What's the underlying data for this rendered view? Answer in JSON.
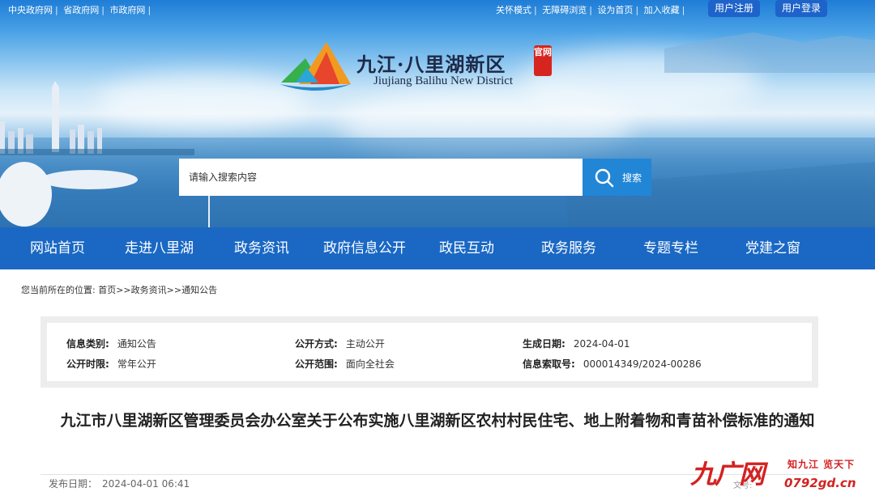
{
  "topbar": {
    "left_links": [
      "中央政府网",
      "省政府网",
      "市政府网"
    ],
    "right_links": [
      "关怀模式",
      "无障碍浏览",
      "设为首页",
      "加入收藏"
    ],
    "register_label": "用户注册",
    "login_label": "用户登录"
  },
  "logo": {
    "title": "九江·八里湖新区",
    "seal": "官网",
    "subtitle": "Jiujiang Balihu New District"
  },
  "search": {
    "placeholder": "请输入搜索内容",
    "button_label": "搜索"
  },
  "nav": {
    "items": [
      "网站首页",
      "走进八里湖",
      "政务资讯",
      "政府信息公开",
      "政民互动",
      "政务服务",
      "专题专栏",
      "党建之窗"
    ]
  },
  "breadcrumb": {
    "prefix": "您当前所在的位置:",
    "path": [
      "首页",
      "政务资讯",
      "通知公告"
    ]
  },
  "info": {
    "category_label": "信息类别:",
    "category": "通知公告",
    "method_label": "公开方式:",
    "method": "主动公开",
    "date_label": "生成日期:",
    "date": "2024-04-01",
    "period_label": "公开时限:",
    "period": "常年公开",
    "scope_label": "公开范围:",
    "scope": "面向全社会",
    "index_label": "信息索取号:",
    "index": "000014349/2024-00286"
  },
  "article": {
    "title": "九江市八里湖新区管理委员会办公室关于公布实施八里湖新区农村村民住宅、地上附着物和青苗补偿标准的通知",
    "publish_label": "发布日期：",
    "publish_date": "2024-04-01 06:41",
    "doc_no_label": "文号:"
  },
  "watermark": {
    "logo": "九广网",
    "slogan": "知九江 览天下",
    "url": "0792gd.cn"
  },
  "colors": {
    "nav_bg": "#1a68c4",
    "search_button": "#2186d6",
    "pill_bg": "#1d63c9",
    "watermark": "#d32222"
  }
}
